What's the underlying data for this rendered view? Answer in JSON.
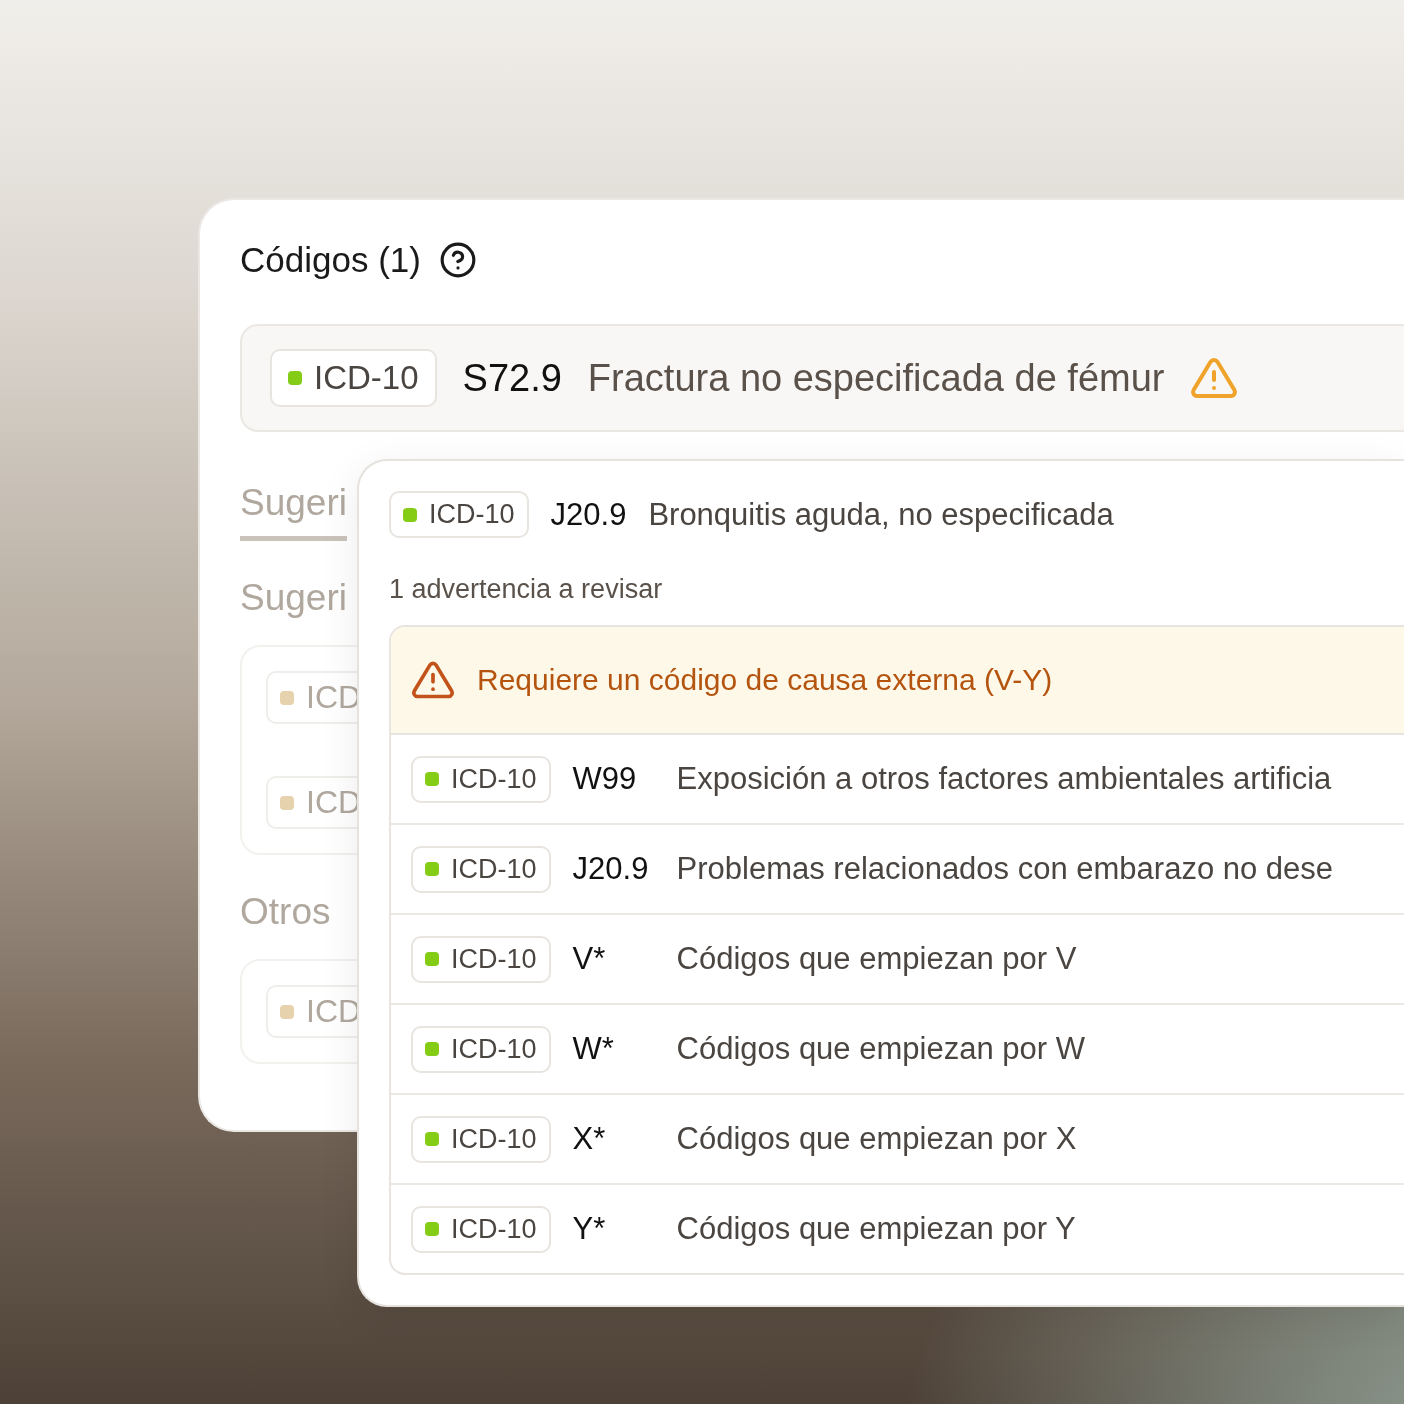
{
  "codes_panel": {
    "title": "Códigos (1)",
    "primary_code": {
      "system": "ICD-10",
      "color": "#84cc16",
      "code": "S72.9",
      "description": "Fractura no especificada de fémur",
      "warning": true
    },
    "tabs": [
      {
        "label": "Sugeri",
        "selected": true
      }
    ],
    "sections": [
      {
        "heading": "Sugeri",
        "tags": [
          {
            "system": "ICD",
            "color": "#e6d2ad"
          },
          {
            "system": "ICD",
            "color": "#e6d2ad"
          }
        ]
      },
      {
        "heading": "Otros",
        "tags": [
          {
            "system": "ICD",
            "color": "#e6d2ad"
          }
        ]
      }
    ]
  },
  "popover": {
    "selected_code": {
      "system": "ICD-10",
      "color": "#84cc16",
      "code": "J20.9",
      "description": "Bronquitis aguda, no especificada"
    },
    "warnings_summary": "1 advertencia a revisar",
    "warning": {
      "message": "Requiere un código de causa externa (V-Y)"
    },
    "options": [
      {
        "system": "ICD-10",
        "color": "#84cc16",
        "code": "W99",
        "description": "Exposición a otros factores ambientales artificia"
      },
      {
        "system": "ICD-10",
        "color": "#84cc16",
        "code": "J20.9",
        "description": "Problemas relacionados con embarazo no dese"
      },
      {
        "system": "ICD-10",
        "color": "#84cc16",
        "code": "V*",
        "description": "Códigos que empiezan por V"
      },
      {
        "system": "ICD-10",
        "color": "#84cc16",
        "code": "W*",
        "description": "Códigos que empiezan por W"
      },
      {
        "system": "ICD-10",
        "color": "#84cc16",
        "code": "X*",
        "description": "Códigos que empiezan por X"
      },
      {
        "system": "ICD-10",
        "color": "#84cc16",
        "code": "Y*",
        "description": "Códigos que empiezan por Y"
      }
    ]
  }
}
